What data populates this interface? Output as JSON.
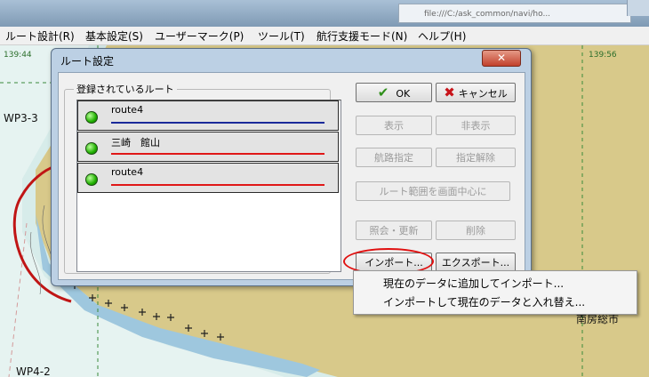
{
  "browser_tab_text": "file:///C:/ask_common/navi/ho...",
  "menu": [
    "ルート設計(R)",
    "基本設定(S)",
    "ユーザーマーク(P)",
    "ツール(T)",
    "航行支援モード(N)",
    "ヘルプ(H)"
  ],
  "map": {
    "coord_left": "139:44",
    "coord_right": "139:56",
    "wp_top": "WP3-3",
    "wp_bottom": "WP4-2",
    "town": "南房総市",
    "route_color": "#c01515"
  },
  "dialog": {
    "title": "ルート設定",
    "close_label": "✕",
    "group_label": "登録されているルート",
    "routes": [
      {
        "name": "route4",
        "line_color": "#1a2a9a"
      },
      {
        "name": "三崎　館山",
        "line_color": "#e01818"
      },
      {
        "name": "route4",
        "line_color": "#e01818"
      }
    ],
    "buttons": {
      "ok": "OK",
      "cancel": "キャンセル",
      "show": "表示",
      "hide": "非表示",
      "route_spec": "航路指定",
      "unspec": "指定解除",
      "center": "ルート範囲を画面中心に",
      "query_update": "照会・更新",
      "delete": "削除",
      "import": "インポート...",
      "export": "エクスポート..."
    }
  },
  "context_menu": [
    "現在のデータに追加してインポート...",
    "インポートして現在のデータと入れ替え..."
  ]
}
